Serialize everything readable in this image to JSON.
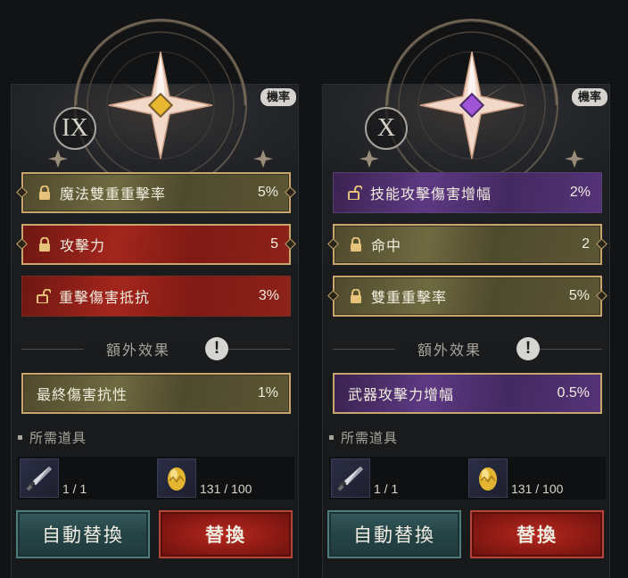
{
  "panels": [
    {
      "roman": "IX",
      "prob_label": "機率",
      "gem_color": "#e8b830",
      "stats": [
        {
          "label": "魔法雙重重擊率",
          "value": "5%",
          "style": "gold",
          "lock": "locked"
        },
        {
          "label": "攻擊力",
          "value": "5",
          "style": "redgold",
          "lock": "locked"
        },
        {
          "label": "重擊傷害抵抗",
          "value": "3%",
          "style": "red",
          "lock": "unlocked"
        }
      ],
      "extra_title": "額外效果",
      "extra_warn": "!",
      "extra_stat": {
        "label": "最終傷害抗性",
        "value": "1%",
        "style": "gold"
      },
      "req_label": "所需道具",
      "items": [
        {
          "icon": "dagger-icon",
          "count": "1 / 1"
        },
        {
          "icon": "golden-egg-icon",
          "count": "131 / 100"
        }
      ],
      "auto_label": "自動替換",
      "swap_label": "替換"
    },
    {
      "roman": "X",
      "prob_label": "機率",
      "gem_color": "#a054d8",
      "stats": [
        {
          "label": "技能攻擊傷害增幅",
          "value": "2%",
          "style": "purple",
          "lock": "unlocked"
        },
        {
          "label": "命中",
          "value": "2",
          "style": "gold",
          "lock": "locked"
        },
        {
          "label": "雙重重擊率",
          "value": "5%",
          "style": "gold",
          "lock": "locked"
        }
      ],
      "extra_title": "額外效果",
      "extra_warn": "!",
      "extra_stat": {
        "label": "武器攻擊力增幅",
        "value": "0.5%",
        "style": "purplegold"
      },
      "req_label": "所需道具",
      "items": [
        {
          "icon": "dagger-icon",
          "count": "1 / 1"
        },
        {
          "icon": "golden-egg-icon",
          "count": "131 / 100"
        }
      ],
      "auto_label": "自動替換",
      "swap_label": "替換"
    }
  ]
}
